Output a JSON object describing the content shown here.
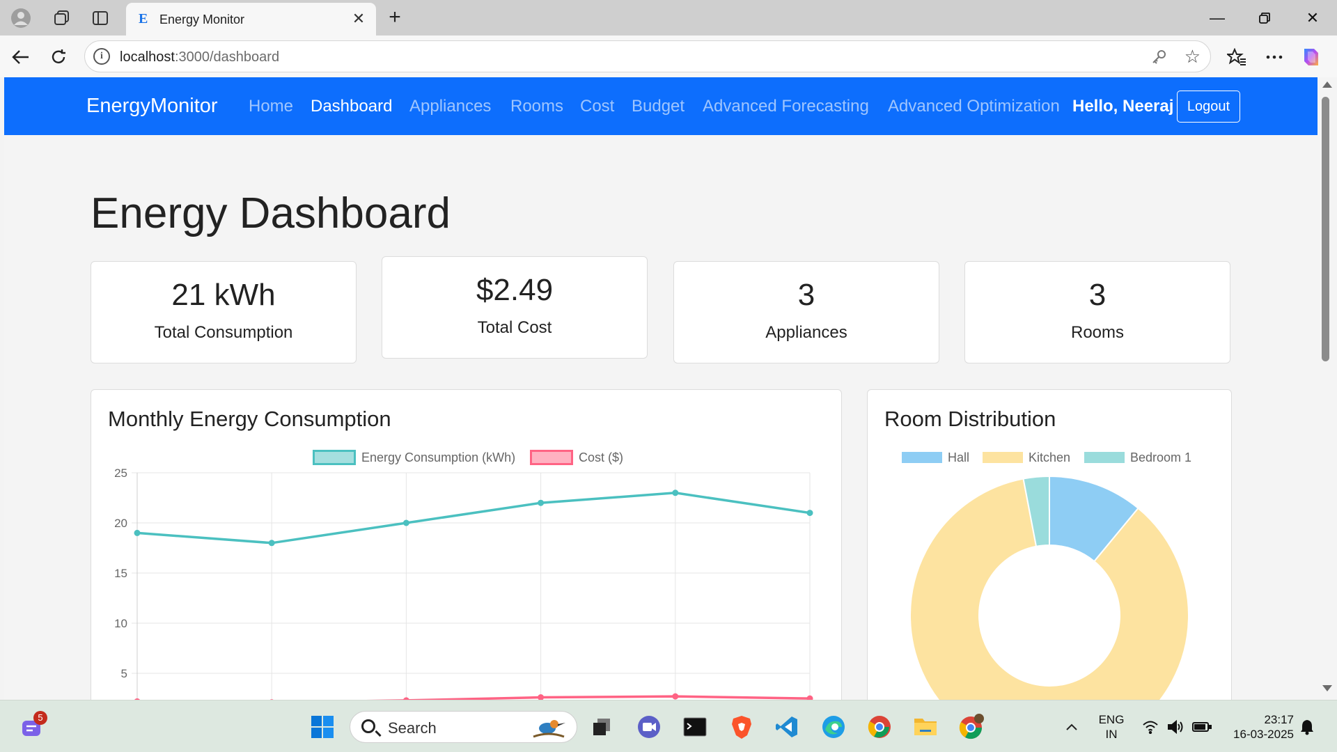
{
  "browser": {
    "tab_title": "Energy Monitor",
    "tab_favicon": "E",
    "url_host": "localhost",
    "url_path": ":3000/dashboard"
  },
  "navbar": {
    "brand": "EnergyMonitor",
    "links": [
      "Home",
      "Dashboard",
      "Appliances",
      "Rooms",
      "Cost",
      "Budget",
      "Advanced Forecasting",
      "Advanced Optimization"
    ],
    "active": "Dashboard",
    "greeting": "Hello, Neeraj",
    "logout_label": "Logout",
    "color": "#0d6efd"
  },
  "page": {
    "title": "Energy Dashboard"
  },
  "stats": [
    {
      "value": "21 kWh",
      "label": "Total Consumption"
    },
    {
      "value": "$2.49",
      "label": "Total Cost"
    },
    {
      "value": "3",
      "label": "Appliances"
    },
    {
      "value": "3",
      "label": "Rooms"
    }
  ],
  "chart_data": [
    {
      "type": "line",
      "title": "Monthly Energy Consumption",
      "series": [
        {
          "name": "Energy Consumption (kWh)",
          "color": "#4bc0c0",
          "values": [
            19,
            18,
            20,
            22,
            23,
            21
          ]
        },
        {
          "name": "Cost ($)",
          "color": "#ff6384",
          "values": [
            2.2,
            2.1,
            2.3,
            2.6,
            2.7,
            2.49
          ]
        }
      ],
      "yticks": [
        25,
        20,
        15,
        10,
        5
      ],
      "ylim": [
        0,
        25
      ],
      "grid": true,
      "legend": "top"
    },
    {
      "type": "pie",
      "title": "Room Distribution",
      "labels": [
        "Hall",
        "Kitchen",
        "Bedroom 1"
      ],
      "values": [
        11,
        86,
        3
      ],
      "colors": [
        "#8ecdf4",
        "#fde3a0",
        "#9adcdc"
      ],
      "legend": "top"
    }
  ],
  "taskbar": {
    "search_placeholder": "Search",
    "badge_count": "5",
    "lang_primary": "ENG",
    "lang_secondary": "IN",
    "time": "23:17",
    "date": "16-03-2025"
  }
}
